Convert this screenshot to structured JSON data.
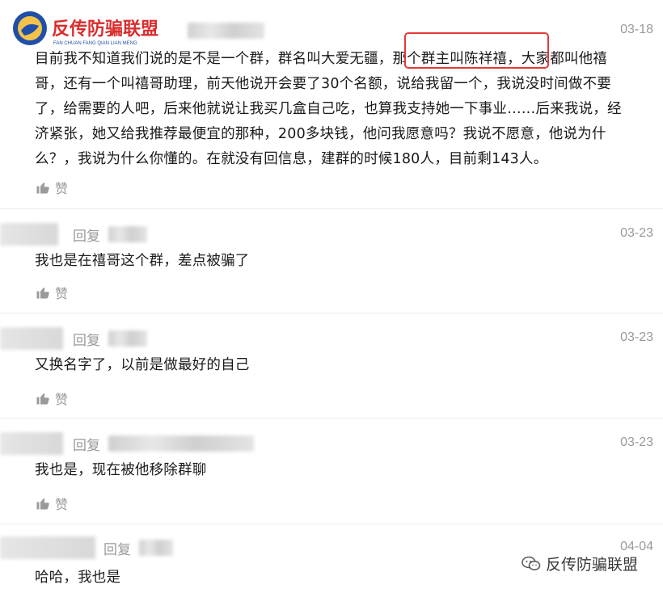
{
  "logo": {
    "title": "反传防骗联盟",
    "subtitle": "FAN CHUAN FANG QIAN LIAN MENG"
  },
  "comments": [
    {
      "date": "03-18",
      "lines": [
        "目前我不知道我们说的是不是一个群，群名叫大爱无疆，那个群主叫陈祥禧，大家都叫他禧",
        "哥，还有一个叫禧哥助理，前天他说开会要了30个名额，说给我留一个，我说没时间做不要",
        "了，给需要的人吧，后来他就说让我买几盒自己吃，也算我支持她一下事业……后来我说，经",
        "济紧张，她又给我推荐最便宜的那种，200多块钱，他问我愿意吗？我说不愿意，他说为什",
        "么？，我说为什么你懂的。在就没有回信息，建群的时候180人，目前剩143人。"
      ],
      "like_label": "赞"
    },
    {
      "date": "03-23",
      "reply_label": "回复",
      "text": "我也是在禧哥这个群，差点被骗了",
      "like_label": "赞"
    },
    {
      "date": "03-23",
      "reply_label": "回复",
      "text": "又换名字了，以前是做最好的自己",
      "like_label": "赞"
    },
    {
      "date": "03-23",
      "reply_label": "回复",
      "text": "我也是，现在被他移除群聊",
      "like_label": "赞"
    },
    {
      "date": "04-04",
      "reply_label": "回复",
      "text": "哈哈，我也是"
    }
  ],
  "watermark": {
    "text": "反传防骗联盟",
    "icon": "wechat-icon"
  },
  "colors": {
    "highlight": "#e53935",
    "muted": "#9a9a9a",
    "text": "#1a1a1a"
  }
}
